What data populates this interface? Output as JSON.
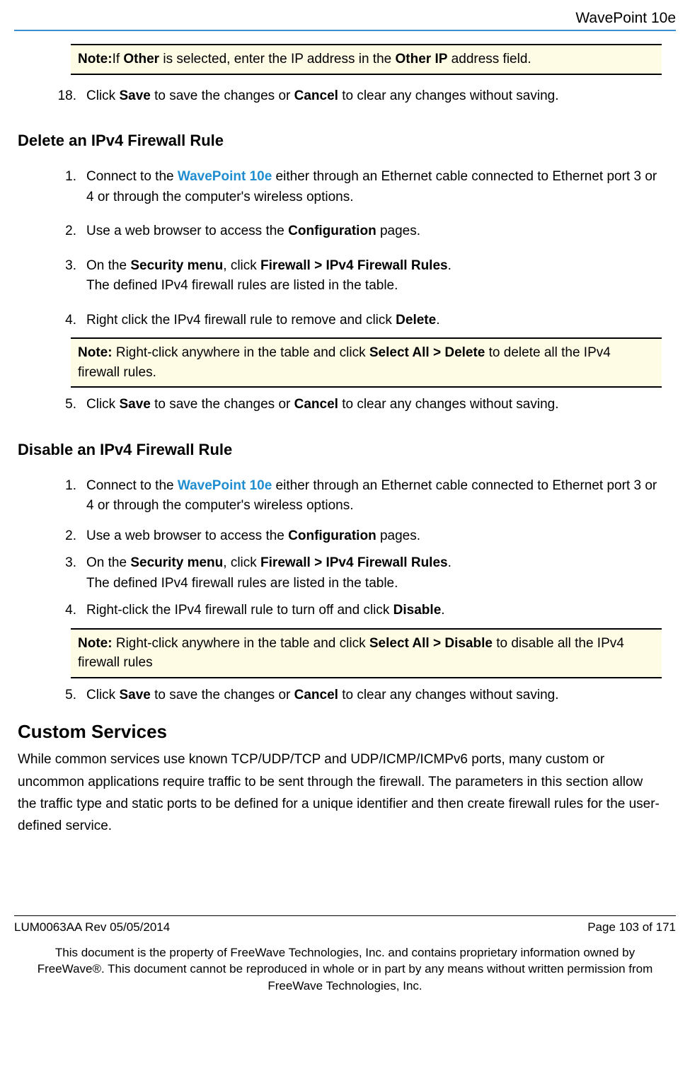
{
  "header": {
    "title": "WavePoint 10e"
  },
  "note1": {
    "label": "Note:",
    "text_pre": "If ",
    "b1": "Other",
    "text_mid": " is selected, enter the IP address in the ",
    "b2": "Other IP",
    "text_post": " address field."
  },
  "step18": {
    "num": "18.",
    "t1": "Click ",
    "b1": "Save",
    "t2": " to save the changes or ",
    "b2": "Cancel",
    "t3": " to clear any changes without saving."
  },
  "delete": {
    "heading": "Delete an IPv4 Firewall Rule",
    "s1": {
      "num": "1.",
      "t1": "Connect to the ",
      "link": "WavePoint 10e",
      "t2": " either through an Ethernet cable connected to Ethernet port 3 or 4 or through the computer's wireless options."
    },
    "s2": {
      "num": "2.",
      "t1": "Use a web browser to access the ",
      "b1": "Configuration",
      "t2": " pages."
    },
    "s3": {
      "num": "3.",
      "t1": "On the ",
      "b1": "Security menu",
      "t2": ", click ",
      "b2": "Firewall > IPv4 Firewall Rules",
      "t3": ".",
      "line2": "The defined IPv4 firewall rules are listed in the table."
    },
    "s4": {
      "num": "4.",
      "t1": "Right click the IPv4 firewall rule to remove and click ",
      "b1": "Delete",
      "t2": "."
    },
    "note": {
      "label": "Note:",
      "t1": " Right-click anywhere in the table and click ",
      "b1": "Select All > Delete",
      "t2": " to delete all the IPv4 firewall rules."
    },
    "s5": {
      "num": "5.",
      "t1": "Click ",
      "b1": "Save",
      "t2": " to save the changes or ",
      "b2": "Cancel",
      "t3": " to clear any changes without saving."
    }
  },
  "disable": {
    "heading": "Disable an IPv4 Firewall Rule",
    "s1": {
      "num": "1.",
      "t1": "Connect to the ",
      "link": "WavePoint 10e",
      "t2": " either through an Ethernet cable connected to Ethernet port 3 or 4 or through the computer's wireless options."
    },
    "s2": {
      "num": "2.",
      "t1": "Use a web browser to access the ",
      "b1": "Configuration",
      "t2": " pages."
    },
    "s3": {
      "num": "3.",
      "t1": "On the ",
      "b1": "Security menu",
      "t2": ", click ",
      "b2": "Firewall > IPv4 Firewall Rules",
      "t3": ".",
      "line2": "The defined IPv4 firewall rules are listed in the table."
    },
    "s4": {
      "num": "4.",
      "t1": "Right-click the IPv4 firewall rule to turn off and click ",
      "b1": "Disable",
      "t2": "."
    },
    "note": {
      "label": "Note:",
      "t1": " Right-click anywhere in the table and click ",
      "b1": "Select All > Disable",
      "t2": " to disable all the IPv4 firewall rules"
    },
    "s5": {
      "num": "5.",
      "t1": "Click ",
      "b1": "Save",
      "t2": " to save the changes or ",
      "b2": "Cancel",
      "t3": " to clear any changes without saving."
    }
  },
  "custom": {
    "heading": "Custom Services",
    "para": "While common services use known TCP/UDP/TCP and UDP/ICMP/ICMPv6 ports, many custom or uncommon applications require traffic to be sent through the firewall. The parameters in this section allow the traffic type and static ports to be defined for a unique identifier and then create firewall rules for the user-defined service."
  },
  "footer": {
    "left": "LUM0063AA Rev 05/05/2014",
    "right": "Page 103 of 171",
    "legal": "This document is the property of FreeWave Technologies, Inc. and contains proprietary information owned by FreeWave®. This document cannot be reproduced in whole or in part by any means without written permission from FreeWave Technologies, Inc."
  }
}
